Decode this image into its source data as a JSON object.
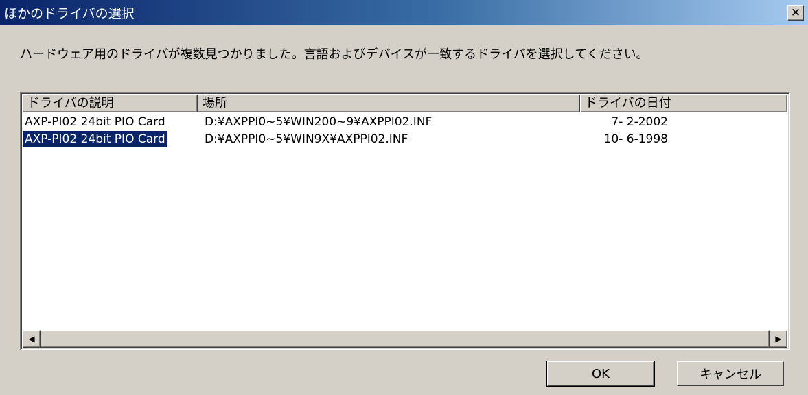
{
  "window": {
    "title": "ほかのドライバの選択",
    "close_glyph": "✕"
  },
  "instruction": "ハードウェア用のドライバが複数見つかりました。言語およびデバイスが一致するドライバを選択してください。",
  "list": {
    "columns": [
      "ドライバの説明",
      "場所",
      "ドライバの日付"
    ],
    "rows": [
      {
        "description": "AXP-PI02 24bit PIO Card",
        "location": "D:¥AXPPI0~5¥WIN200~9¥AXPPI02.INF",
        "date": "7- 2-2002",
        "selected": false
      },
      {
        "description": "AXP-PI02 24bit PIO Card",
        "location": "D:¥AXPPI0~5¥WIN9X¥AXPPI02.INF",
        "date": "10- 6-1998",
        "selected": true
      }
    ],
    "scroll_left_icon": "◀",
    "scroll_right_icon": "▶"
  },
  "buttons": {
    "ok": "OK",
    "cancel": "キャンセル"
  },
  "colors": {
    "selection": "#0a246a",
    "title_gradient_start": "#0a246a",
    "title_gradient_end": "#a6caf0",
    "face": "#d4d0c8"
  }
}
